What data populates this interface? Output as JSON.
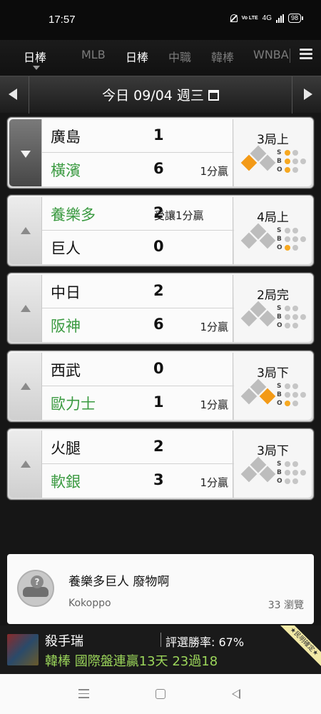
{
  "status_bar": {
    "time": "17:57",
    "volte": "Vo LTE",
    "network": "4G",
    "battery": "98"
  },
  "tabs": [
    {
      "label": "日棒",
      "active": true
    },
    {
      "label": "MLB"
    },
    {
      "label": "日棒"
    },
    {
      "label": "中職"
    },
    {
      "label": "韓棒"
    },
    {
      "label": "WNBA"
    }
  ],
  "date_bar": {
    "text": "今日 09/04 週三"
  },
  "games": [
    {
      "vote_state": "down-selected",
      "top": {
        "name": "廣島",
        "score": "1",
        "note": "",
        "winner": false
      },
      "bottom": {
        "name": "橫濱",
        "score": "6",
        "note": "1分贏",
        "winner": true
      },
      "inning": "3局上",
      "bases": {
        "first": false,
        "second": false,
        "third": true
      },
      "count": {
        "strikes": 1,
        "balls": 1,
        "outs": 1
      }
    },
    {
      "vote_state": "up",
      "top": {
        "name": "養樂多",
        "score": "2",
        "note": "受讓1分贏",
        "winner": true
      },
      "bottom": {
        "name": "巨人",
        "score": "0",
        "note": "",
        "winner": false
      },
      "inning": "4局上",
      "bases": {
        "first": false,
        "second": false,
        "third": false
      },
      "count": {
        "strikes": 0,
        "balls": 0,
        "outs": 1
      }
    },
    {
      "vote_state": "up",
      "top": {
        "name": "中日",
        "score": "2",
        "note": "",
        "winner": false
      },
      "bottom": {
        "name": "阪神",
        "score": "6",
        "note": "1分贏",
        "winner": true
      },
      "inning": "2局完",
      "bases": {
        "first": false,
        "second": false,
        "third": false
      },
      "count": {
        "strikes": 0,
        "balls": 0,
        "outs": 0
      }
    },
    {
      "vote_state": "up",
      "top": {
        "name": "西武",
        "score": "0",
        "note": "",
        "winner": false
      },
      "bottom": {
        "name": "歐力士",
        "score": "1",
        "note": "1分贏",
        "winner": true
      },
      "inning": "3局下",
      "bases": {
        "first": true,
        "second": false,
        "third": false
      },
      "count": {
        "strikes": 0,
        "balls": 0,
        "outs": 1
      }
    },
    {
      "vote_state": "up",
      "top": {
        "name": "火腿",
        "score": "2",
        "note": "",
        "winner": false
      },
      "bottom": {
        "name": "軟銀",
        "score": "3",
        "note": "1分贏",
        "winner": true
      },
      "inning": "3局下",
      "bases": {
        "first": false,
        "second": false,
        "third": false
      },
      "count": {
        "strikes": 0,
        "balls": 0,
        "outs": 0
      }
    }
  ],
  "sbo_labels": [
    "S",
    "B",
    "O"
  ],
  "post": {
    "title": "養樂多巨人 廢物啊",
    "author": "Kokoppo",
    "views": "33 瀏覽"
  },
  "banner": {
    "name": "殺手瑞",
    "rate": "評選勝率: 67%",
    "line": "韓棒 國際盤連贏13天 23過18",
    "ribbon": "★民明確定★"
  },
  "colors": {
    "win_green": "#3a9a40",
    "base_on": "#f39a17",
    "accent_line": "#9bd55a"
  }
}
